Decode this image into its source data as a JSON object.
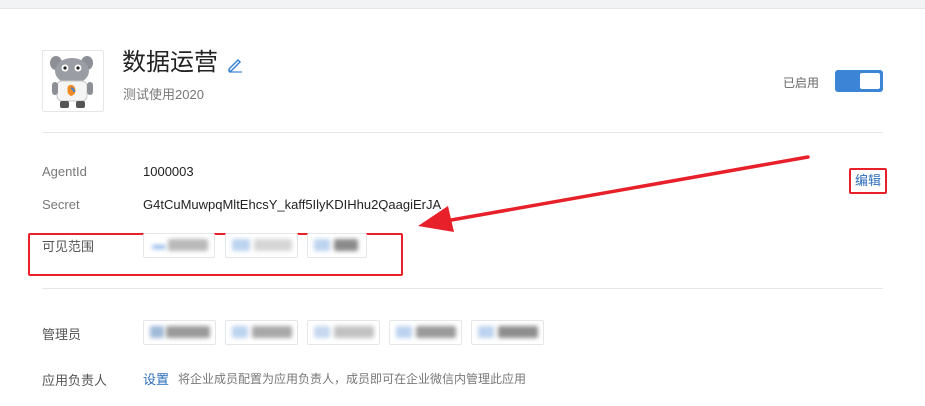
{
  "app": {
    "title": "数据运营",
    "description": "测试使用2020",
    "status_label": "已启用",
    "enabled": true
  },
  "fields": {
    "agentid_label": "AgentId",
    "agentid_value": "1000003",
    "secret_label": "Secret",
    "secret_value": "G4tCuMuwpqMltEhcsY_kaff5IlyKDIHhu2QaagiErJA",
    "edit_label": "编辑",
    "scope_label": "可见范围"
  },
  "admins": {
    "label": "管理员"
  },
  "owner": {
    "label": "应用负责人",
    "setup_link": "设置",
    "hint": "将企业成员配置为应用负责人，成员即可在企业微信内管理此应用"
  },
  "colors": {
    "accent": "#3b84d6",
    "annotation": "#e8202a",
    "link": "#2c6ebd"
  },
  "icons": {
    "edit_name": "pencil-icon",
    "avatar": "mascot-avatar"
  }
}
